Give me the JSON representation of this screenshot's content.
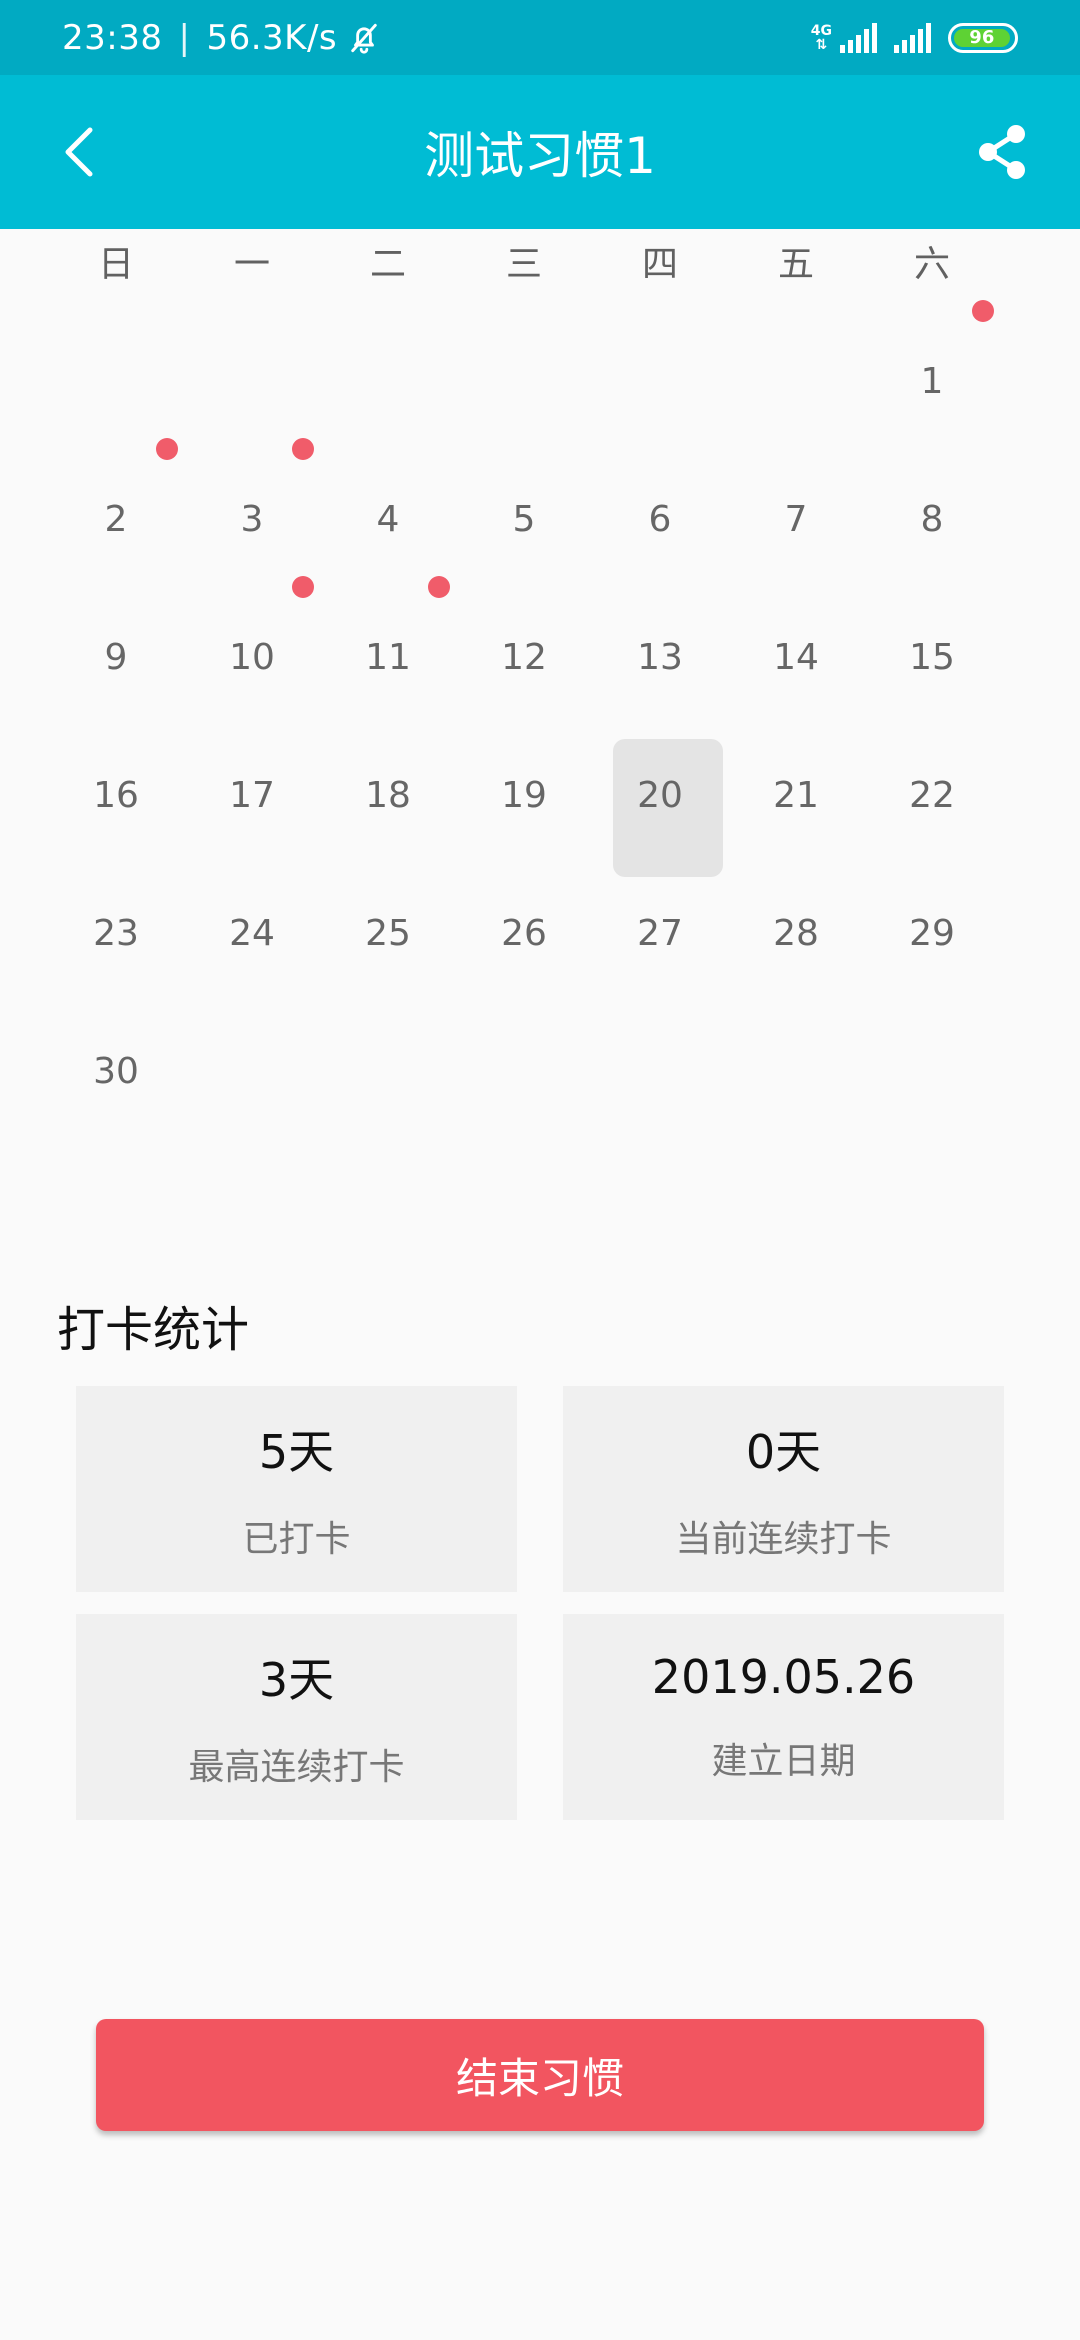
{
  "status_bar": {
    "time": "23:38",
    "separator": "|",
    "speed": "56.3K/s",
    "network_label": "4G",
    "battery": "96",
    "battery_level": 0.96
  },
  "app_bar": {
    "title": "测试习惯1",
    "back_icon": "back-arrow-icon",
    "share_icon": "share-icon"
  },
  "calendar": {
    "weekdays": [
      "日",
      "一",
      "二",
      "三",
      "四",
      "五",
      "六"
    ],
    "days": [
      {
        "label": ""
      },
      {
        "label": ""
      },
      {
        "label": ""
      },
      {
        "label": ""
      },
      {
        "label": ""
      },
      {
        "label": ""
      },
      {
        "label": "1",
        "checked": true
      },
      {
        "label": "2",
        "checked": true
      },
      {
        "label": "3",
        "checked": true
      },
      {
        "label": "4"
      },
      {
        "label": "5"
      },
      {
        "label": "6"
      },
      {
        "label": "7"
      },
      {
        "label": "8"
      },
      {
        "label": "9"
      },
      {
        "label": "10",
        "checked": true
      },
      {
        "label": "11",
        "checked": true
      },
      {
        "label": "12"
      },
      {
        "label": "13"
      },
      {
        "label": "14"
      },
      {
        "label": "15"
      },
      {
        "label": "16"
      },
      {
        "label": "17"
      },
      {
        "label": "18"
      },
      {
        "label": "19"
      },
      {
        "label": "20",
        "selected": true
      },
      {
        "label": "21"
      },
      {
        "label": "22"
      },
      {
        "label": "23"
      },
      {
        "label": "24"
      },
      {
        "label": "25"
      },
      {
        "label": "26"
      },
      {
        "label": "27"
      },
      {
        "label": "28"
      },
      {
        "label": "29"
      },
      {
        "label": "30"
      }
    ],
    "dot_color": "#f05c6a"
  },
  "stats": {
    "heading": "打卡统计",
    "cards": [
      {
        "value": "5天",
        "label": "已打卡"
      },
      {
        "value": "0天",
        "label": "当前连续打卡"
      },
      {
        "value": "3天",
        "label": "最高连续打卡"
      },
      {
        "value": "2019.05.26",
        "label": "建立日期"
      }
    ]
  },
  "end_button": {
    "label": "结束习惯",
    "color": "#f25560"
  },
  "colors": {
    "status_bar": "#01aac2",
    "app_bar": "#00bcd4",
    "background": "#fafafa"
  }
}
